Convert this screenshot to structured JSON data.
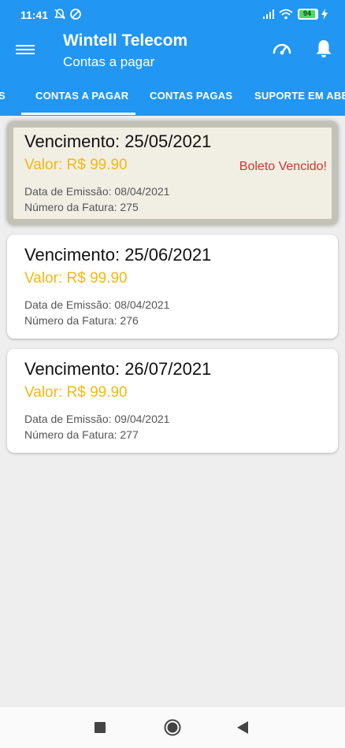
{
  "status_bar": {
    "time": "11:41",
    "battery": "94",
    "icons": [
      "muted-bell-icon",
      "vpn-icon",
      "signal-icon",
      "wifi-icon",
      "battery-icon",
      "charging-icon"
    ]
  },
  "app_bar": {
    "title": "Wintell Telecom",
    "subtitle": "Contas a pagar",
    "icons": [
      "menu-icon",
      "speedometer-icon",
      "bell-icon"
    ],
    "color": "#2196f3"
  },
  "tabs": [
    {
      "label": "S"
    },
    {
      "label": "CONTAS A PAGAR",
      "selected": true
    },
    {
      "label": "CONTAS PAGAS"
    },
    {
      "label": "SUPORTE EM ABER"
    }
  ],
  "bills": [
    {
      "vencimento": "Vencimento: 25/05/2021",
      "valor": "Valor: R$ 99.90",
      "status": "Boleto Vencido!",
      "emissao": "Data de Emissão: 08/04/2021",
      "fatura": "Número da Fatura: 275"
    },
    {
      "vencimento": "Vencimento: 25/06/2021",
      "valor": "Valor: R$ 99.90",
      "emissao": "Data de Emissão: 08/04/2021",
      "fatura": "Número da Fatura: 276"
    },
    {
      "vencimento": "Vencimento: 26/07/2021",
      "valor": "Valor: R$ 99.90",
      "emissao": "Data de Emissão: 09/04/2021",
      "fatura": "Número da Fatura: 277"
    }
  ],
  "colors": {
    "primary": "#2196f3",
    "valor": "#f2b90f",
    "overdue": "#d0352f"
  },
  "nav_bar": {
    "icons": [
      "recents-square-icon",
      "home-circle-icon",
      "back-triangle-icon"
    ]
  }
}
